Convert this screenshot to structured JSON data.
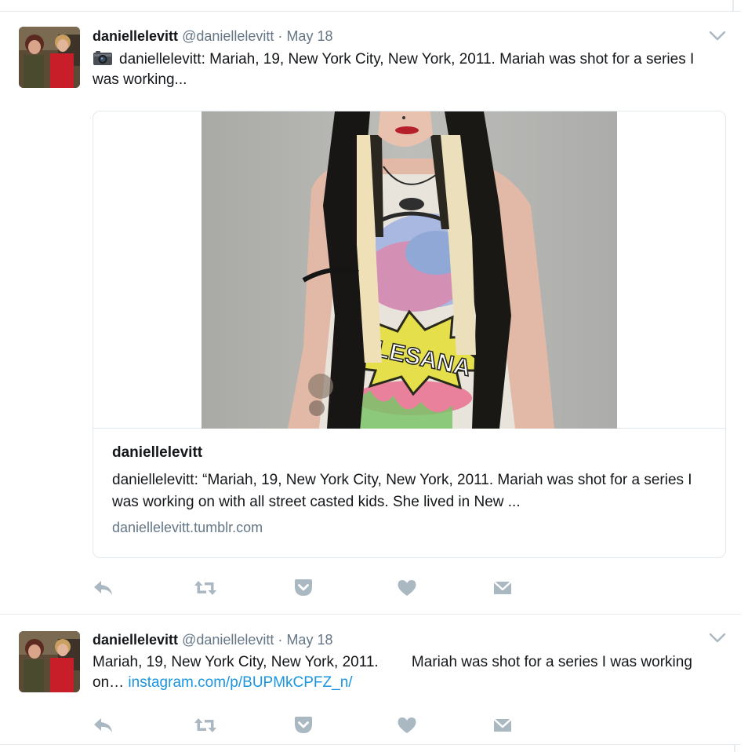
{
  "tweets": [
    {
      "fullname": "daniellelevitt",
      "handle": "@daniellelevitt",
      "separator": "·",
      "time": "May 18",
      "text": "daniellelevitt: Mariah, 19, New York City, New York, 2011. Mariah was shot for a series I was working...",
      "text_icon": "camera-icon",
      "card": {
        "title": "daniellelevitt",
        "description": "daniellelevitt: “Mariah, 19, New York City, New York, 2011. Mariah was shot for a series I was working on with all street casted kids. She lived in New ...",
        "domain": "daniellelevitt.tumblr.com",
        "image_shirt_text": "ALESANA"
      },
      "actions": [
        "reply-icon",
        "retweet-icon",
        "pocket-icon",
        "like-icon",
        "direct-message-icon"
      ]
    },
    {
      "fullname": "daniellelevitt",
      "handle": "@daniellelevitt",
      "separator": "·",
      "time": "May 18",
      "text_plain": "Mariah, 19, New York City, New York, 2011.        Mariah was shot for a series I was working on… ",
      "text_link": "instagram.com/p/BUPMkCPFZ_n/",
      "actions": [
        "reply-icon",
        "retweet-icon",
        "pocket-icon",
        "like-icon",
        "direct-message-icon"
      ]
    }
  ],
  "colors": {
    "text": "#14171a",
    "secondary": "#657786",
    "link": "#1b95e0",
    "border": "#e1e8ed",
    "action_icon": "#aab8c2"
  }
}
